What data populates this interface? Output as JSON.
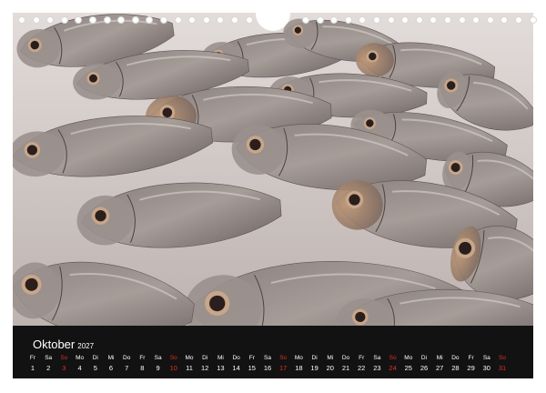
{
  "calendar": {
    "month": "Oktober",
    "year": "2027",
    "days": [
      {
        "wd": "Fr",
        "d": "1",
        "weekend": false
      },
      {
        "wd": "Sa",
        "d": "2",
        "weekend": false
      },
      {
        "wd": "So",
        "d": "3",
        "weekend": true
      },
      {
        "wd": "Mo",
        "d": "4",
        "weekend": false
      },
      {
        "wd": "Di",
        "d": "5",
        "weekend": false
      },
      {
        "wd": "Mi",
        "d": "6",
        "weekend": false
      },
      {
        "wd": "Do",
        "d": "7",
        "weekend": false
      },
      {
        "wd": "Fr",
        "d": "8",
        "weekend": false
      },
      {
        "wd": "Sa",
        "d": "9",
        "weekend": false
      },
      {
        "wd": "So",
        "d": "10",
        "weekend": true
      },
      {
        "wd": "Mo",
        "d": "11",
        "weekend": false
      },
      {
        "wd": "Di",
        "d": "12",
        "weekend": false
      },
      {
        "wd": "Mi",
        "d": "13",
        "weekend": false
      },
      {
        "wd": "Do",
        "d": "14",
        "weekend": false
      },
      {
        "wd": "Fr",
        "d": "15",
        "weekend": false
      },
      {
        "wd": "Sa",
        "d": "16",
        "weekend": false
      },
      {
        "wd": "So",
        "d": "17",
        "weekend": true
      },
      {
        "wd": "Mo",
        "d": "18",
        "weekend": false
      },
      {
        "wd": "Di",
        "d": "19",
        "weekend": false
      },
      {
        "wd": "Mi",
        "d": "20",
        "weekend": false
      },
      {
        "wd": "Do",
        "d": "21",
        "weekend": false
      },
      {
        "wd": "Fr",
        "d": "22",
        "weekend": false
      },
      {
        "wd": "Sa",
        "d": "23",
        "weekend": false
      },
      {
        "wd": "So",
        "d": "24",
        "weekend": true
      },
      {
        "wd": "Mo",
        "d": "25",
        "weekend": false
      },
      {
        "wd": "Di",
        "d": "26",
        "weekend": false
      },
      {
        "wd": "Mi",
        "d": "27",
        "weekend": false
      },
      {
        "wd": "Do",
        "d": "28",
        "weekend": false
      },
      {
        "wd": "Fr",
        "d": "29",
        "weekend": false
      },
      {
        "wd": "Sa",
        "d": "30",
        "weekend": false
      },
      {
        "wd": "So",
        "d": "31",
        "weekend": true
      }
    ]
  },
  "colors": {
    "calendar_bar": "#121212",
    "weekend_text": "#e0301e",
    "ice": "#dcd6d4",
    "fish_body": "#8f8684",
    "fish_golden": "#b0896a",
    "fish_eye": "#2a1f1c"
  }
}
